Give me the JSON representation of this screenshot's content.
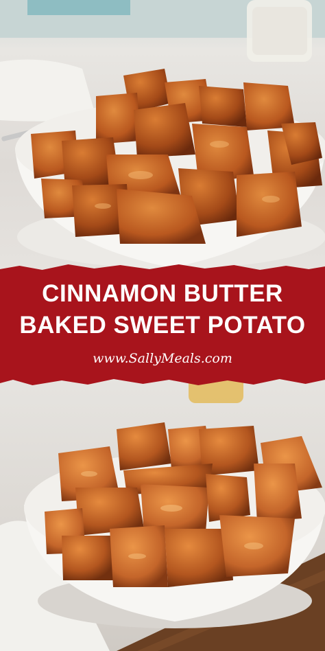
{
  "banner": {
    "title_line1": "CINNAMON BUTTER",
    "title_line2": "BAKED SWEET POTATO",
    "website": "www.SallyMeals.com"
  },
  "colors": {
    "banner": "#a8141c",
    "potato": "#c9682a",
    "potato_dark": "#8f3f17",
    "bowl": "#f7f6f3"
  }
}
